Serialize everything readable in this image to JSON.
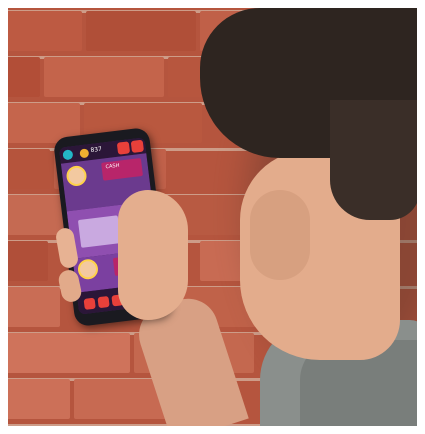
{
  "scene": {
    "description_free": true,
    "colors": {
      "brick": "#b5553e",
      "mortar": "#d6b4a0",
      "skin": "#e3ac8c",
      "hair": "#2e2520",
      "phone_body": "#1a1a20",
      "app_purple": "#3b2055",
      "app_accent_red": "#e8403a",
      "app_accent_teal": "#23b7c7"
    }
  },
  "phone": {
    "cash_label": "837",
    "title_1": "CASH",
    "icons": [
      "gear-icon",
      "coin-icon",
      "shop-icon"
    ]
  }
}
